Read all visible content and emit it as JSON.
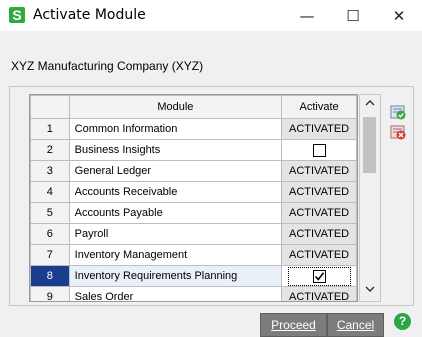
{
  "window": {
    "title": "Activate Module",
    "app_icon_letter": "S",
    "minimize_glyph": "—",
    "maximize_glyph": "☐",
    "close_glyph": "✕"
  },
  "company": "XYZ Manufacturing Company (XYZ)",
  "grid": {
    "headers": {
      "num": "",
      "module": "Module",
      "activate": "Activate"
    },
    "rows": [
      {
        "num": "1",
        "module": "Common Information",
        "activate": "ACTIVATED"
      },
      {
        "num": "2",
        "module": "Business Insights",
        "activate": ""
      },
      {
        "num": "3",
        "module": "General Ledger",
        "activate": "ACTIVATED"
      },
      {
        "num": "4",
        "module": "Accounts Receivable",
        "activate": "ACTIVATED"
      },
      {
        "num": "5",
        "module": "Accounts Payable",
        "activate": "ACTIVATED"
      },
      {
        "num": "6",
        "module": "Payroll",
        "activate": "ACTIVATED"
      },
      {
        "num": "7",
        "module": "Inventory Management",
        "activate": "ACTIVATED"
      },
      {
        "num": "8",
        "module": "Inventory Requirements Planning",
        "activate": ""
      },
      {
        "num": "9",
        "module": "Sales Order",
        "activate": "ACTIVATED"
      }
    ],
    "row2_checkbox": "unchecked",
    "row8_checkbox": "checked",
    "selected_row": "8"
  },
  "scrollbar": {
    "up_glyph": "^",
    "down_glyph": "v"
  },
  "side_icons": [
    "select-all-icon",
    "clear-all-icon"
  ],
  "buttons": {
    "proceed": "Proceed",
    "cancel": "Cancel",
    "help": "?"
  },
  "colors": {
    "accent_selected": "#1a3d8f",
    "button_bg": "#7c7c7c",
    "help_green": "#2ca644"
  }
}
